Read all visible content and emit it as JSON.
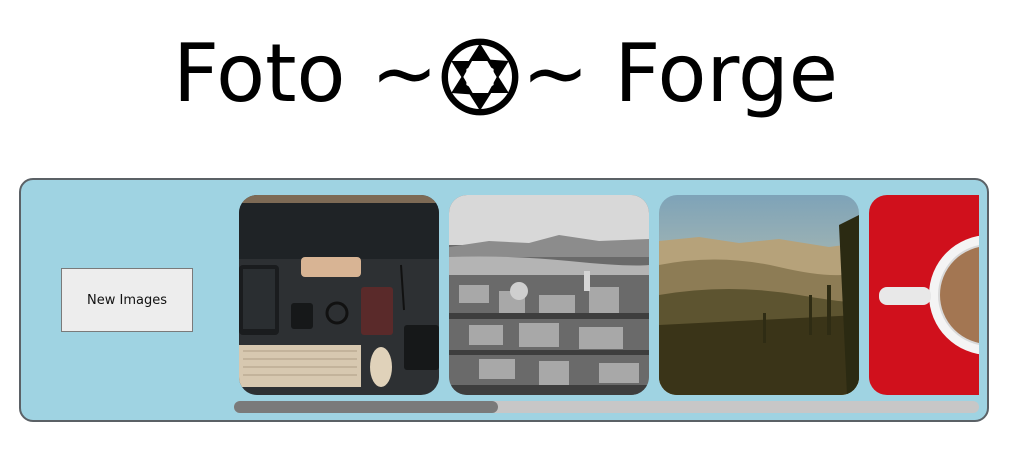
{
  "header": {
    "title_left": "Foto ~",
    "title_right": "~ Forge",
    "logo_icon": "camera-aperture-icon"
  },
  "panel": {
    "background": "#9fd3e2",
    "new_images_label": "New Images"
  },
  "gallery": {
    "images": [
      {
        "name": "desk-workspace-photo"
      },
      {
        "name": "city-aerial-photo"
      },
      {
        "name": "hills-landscape-photo"
      },
      {
        "name": "coffee-cup-photo"
      }
    ],
    "scroll_fraction_visible": 0.355,
    "scroll_position": 0
  }
}
